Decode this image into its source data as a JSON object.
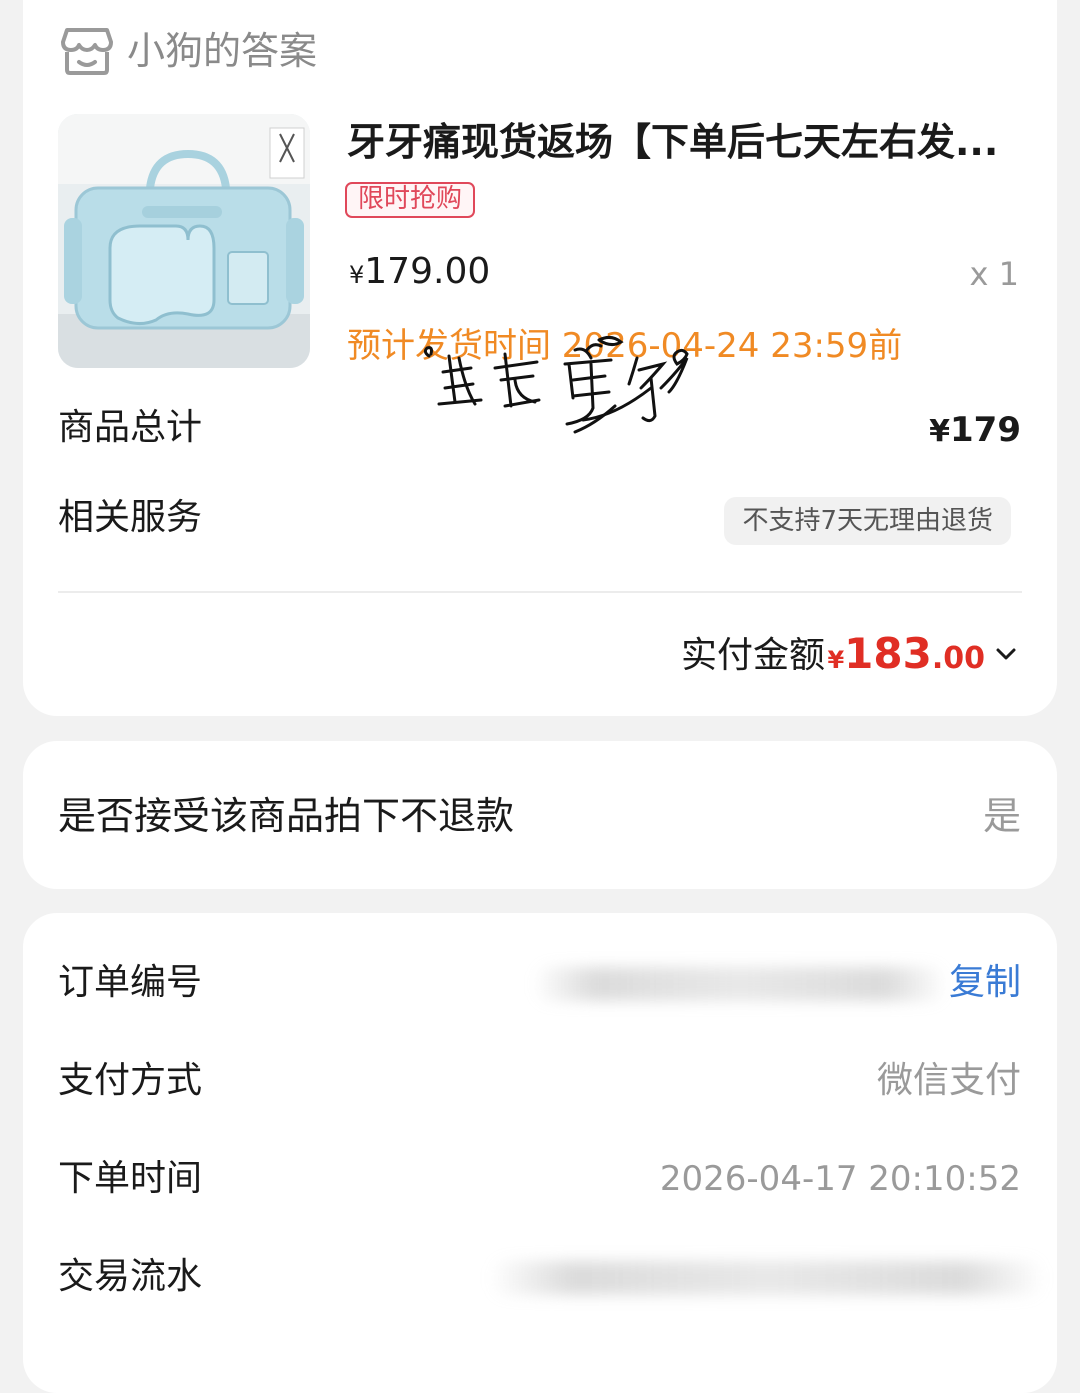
{
  "shop": {
    "icon": "store-icon",
    "name": "小狗的答案"
  },
  "product": {
    "image": "product-bag-image",
    "title": "牙牙痛现货返场【下单后七天左右发...",
    "badge": "限时抢购",
    "price_symbol": "¥",
    "price": "179.00",
    "quantity": "x 1",
    "shipping_estimate": "预计发货时间 2026-04-24 23:59前"
  },
  "summary": {
    "total_label": "商品总计",
    "total_symbol": "¥",
    "total_value": "179",
    "service_label": "相关服务",
    "service_tag": "不支持7天无理由退货",
    "paid_label": "实付金额",
    "paid_symbol": "¥",
    "paid_integer": "183",
    "paid_decimal": ".00",
    "expand_icon": "chevron-down-icon"
  },
  "watermark": "酱香鱼仔",
  "refund": {
    "label": "是否接受该商品拍下不退款",
    "value": "是"
  },
  "order_info": {
    "order_no_label": "订单编号",
    "copy_label": "复制",
    "payment_label": "支付方式",
    "payment_value": "微信支付",
    "time_label": "下单时间",
    "time_value": "2026-04-17 20:10:52",
    "txn_label": "交易流水"
  },
  "colors": {
    "accent_red": "#e02e24",
    "badge_red": "#e0485a",
    "orange": "#f08a24",
    "link_blue": "#3a7bd5",
    "muted": "#9a9a9a"
  }
}
